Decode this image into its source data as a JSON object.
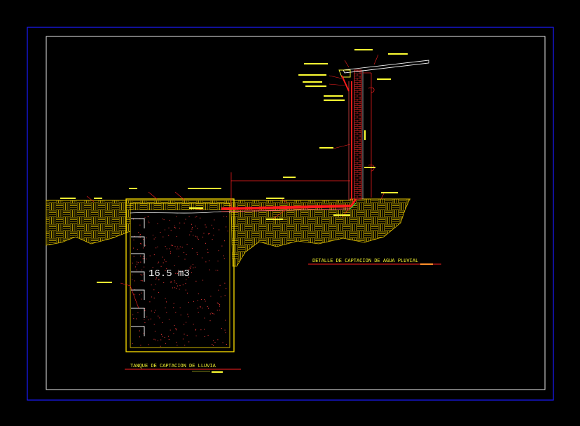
{
  "colors": {
    "background": "#000000",
    "outer_frame": "#1a1aff",
    "inner_frame": "#f0f0f0",
    "ground_hatch": "#e0c000",
    "labels": "#ffff33",
    "leaders": "#ff2020",
    "water_dots": "#ff3b3b",
    "volume_text": "#f0f0f0",
    "pipe": "#ff1a1a",
    "wall_brick": "#ff3030",
    "gutter_green": "#33dd33"
  },
  "drawing": {
    "tank_volume": "16.5  m3",
    "tank_title": "TANQUE  DE  CAPTACION  DE  LLUVIA",
    "detail_title": "DETALLE  DE  CAPTACION  DE  AGUA  PLUVIAL"
  },
  "icons": {
    "wall": "brick-wall-icon",
    "tank": "cistern-icon"
  }
}
